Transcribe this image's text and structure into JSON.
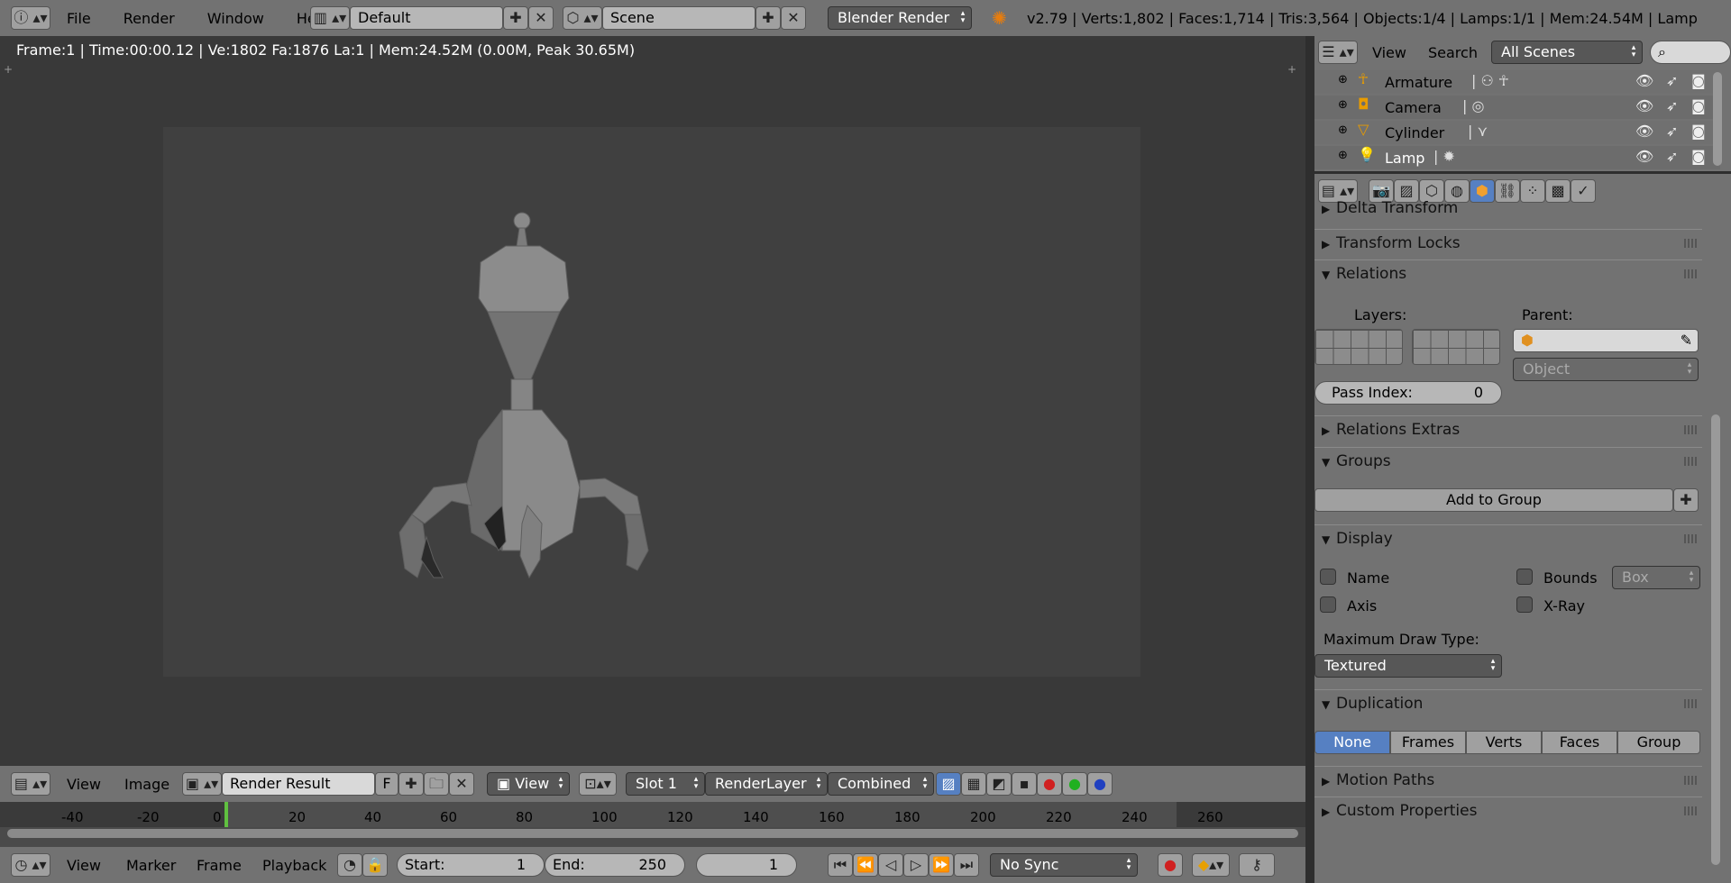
{
  "topbar": {
    "menus": [
      "File",
      "Render",
      "Window",
      "Help"
    ],
    "layout": "Default",
    "scene": "Scene",
    "engine": "Blender Render",
    "stats": "v2.79 | Verts:1,802 | Faces:1,714 | Tris:3,564 | Objects:1/4 | Lamps:1/1 | Mem:24.54M | Lamp"
  },
  "viewer": {
    "info": "Frame:1 | Time:00:00.12 | Ve:1802 Fa:1876 La:1 | Mem:24.52M (0.00M, Peak 30.65M)"
  },
  "image_header": {
    "menus": [
      "View",
      "Image"
    ],
    "image_name": "Render Result",
    "fake_user": "F",
    "view": "View",
    "slot": "Slot 1",
    "layer": "RenderLayer",
    "pass": "Combined"
  },
  "timeline": {
    "ticks": [
      "-40",
      "-20",
      "0",
      "20",
      "40",
      "60",
      "80",
      "100",
      "120",
      "140",
      "160",
      "180",
      "200",
      "220",
      "240",
      "260"
    ],
    "current_frame_fraction": 0.0
  },
  "timeline_header": {
    "menus": [
      "View",
      "Marker",
      "Frame",
      "Playback"
    ],
    "start_label": "Start:",
    "start_value": "1",
    "end_label": "End:",
    "end_value": "250",
    "current": "1",
    "sync": "No Sync"
  },
  "outliner": {
    "menus": [
      "View",
      "Search"
    ],
    "scope": "All Scenes",
    "items": [
      {
        "name": "Armature"
      },
      {
        "name": "Camera"
      },
      {
        "name": "Cylinder"
      },
      {
        "name": "Lamp"
      }
    ]
  },
  "properties": {
    "panels": {
      "delta": "Delta Transform",
      "locks": "Transform Locks",
      "relations": "Relations",
      "relations_extras": "Relations Extras",
      "groups": "Groups",
      "display": "Display",
      "duplication": "Duplication",
      "motion_paths": "Motion Paths",
      "custom_props": "Custom Properties"
    },
    "relations": {
      "layers_label": "Layers:",
      "parent_label": "Parent:",
      "parent_type": "Object",
      "pass_index_label": "Pass Index:",
      "pass_index_value": "0"
    },
    "groups": {
      "add": "Add to Group"
    },
    "display": {
      "name": "Name",
      "axis": "Axis",
      "bounds": "Bounds",
      "bounds_type": "Box",
      "xray": "X-Ray",
      "max_draw_label": "Maximum Draw Type:",
      "max_draw_value": "Textured"
    },
    "duplication": {
      "options": [
        "None",
        "Frames",
        "Verts",
        "Faces",
        "Group"
      ],
      "selected": "None"
    }
  },
  "colors": {
    "accent": "#5680c2",
    "header": "#727272",
    "panel_bg": "#727272",
    "viewport_bg": "#393939",
    "render_bg": "#404040",
    "frame_marker": "#60c040"
  }
}
